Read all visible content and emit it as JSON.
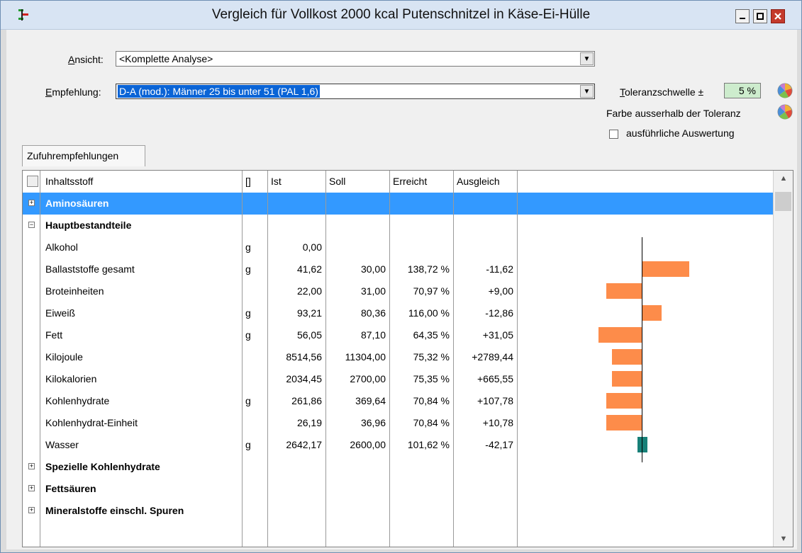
{
  "window": {
    "title": "Vergleich für Vollkost 2000 kcal Putenschnitzel in Käse-Ei-Hülle"
  },
  "controls": {
    "ansicht_label_u": "A",
    "ansicht_label_rest": "nsicht:",
    "ansicht_value": "<Komplette Analyse>",
    "empfehlung_label_u": "E",
    "empfehlung_label_rest": "mpfehlung:",
    "empfehlung_value": "D-A (mod.): Männer 25 bis unter 51 (PAL 1,6)",
    "toleranz_label_u": "T",
    "toleranz_label_rest": "oleranzschwelle ±",
    "toleranz_value": "5 %",
    "farbe_label": "Farbe ausserhalb der Toleranz",
    "ausfuehrlich_label": "ausführliche Auswertung",
    "ausfuehrlich_checked": false
  },
  "tabs": [
    "Zufuhrempfehlungen"
  ],
  "columns": {
    "name": "Inhaltsstoff",
    "unit": "[]",
    "ist": "Ist",
    "soll": "Soll",
    "erreicht": "Erreicht",
    "ausgleich": "Ausgleich"
  },
  "rows": [
    {
      "type": "group",
      "name": "Aminosäuren",
      "expanded": false,
      "selected": true
    },
    {
      "type": "group",
      "name": "Hauptbestandteile",
      "expanded": true,
      "selected": false
    },
    {
      "type": "item",
      "name": "Alkohol",
      "unit": "g",
      "ist": "0,00",
      "soll": "",
      "erreicht": "",
      "ausgleich": "",
      "percent": null
    },
    {
      "type": "item",
      "name": "Ballaststoffe gesamt",
      "unit": "g",
      "ist": "41,62",
      "soll": "30,00",
      "erreicht": "138,72 %",
      "ausgleich": "-11,62",
      "percent": 138.72
    },
    {
      "type": "item",
      "name": "Broteinheiten",
      "unit": "",
      "ist": "22,00",
      "soll": "31,00",
      "erreicht": "70,97 %",
      "ausgleich": "+9,00",
      "percent": 70.97
    },
    {
      "type": "item",
      "name": "Eiweiß",
      "unit": "g",
      "ist": "93,21",
      "soll": "80,36",
      "erreicht": "116,00 %",
      "ausgleich": "-12,86",
      "percent": 116.0
    },
    {
      "type": "item",
      "name": "Fett",
      "unit": "g",
      "ist": "56,05",
      "soll": "87,10",
      "erreicht": "64,35 %",
      "ausgleich": "+31,05",
      "percent": 64.35
    },
    {
      "type": "item",
      "name": "Kilojoule",
      "unit": "",
      "ist": "8514,56",
      "soll": "11304,00",
      "erreicht": "75,32 %",
      "ausgleich": "+2789,44",
      "percent": 75.32
    },
    {
      "type": "item",
      "name": "Kilokalorien",
      "unit": "",
      "ist": "2034,45",
      "soll": "2700,00",
      "erreicht": "75,35 %",
      "ausgleich": "+665,55",
      "percent": 75.35
    },
    {
      "type": "item",
      "name": "Kohlenhydrate",
      "unit": "g",
      "ist": "261,86",
      "soll": "369,64",
      "erreicht": "70,84 %",
      "ausgleich": "+107,78",
      "percent": 70.84
    },
    {
      "type": "item",
      "name": "Kohlenhydrat-Einheit",
      "unit": "",
      "ist": "26,19",
      "soll": "36,96",
      "erreicht": "70,84 %",
      "ausgleich": "+10,78",
      "percent": 70.84
    },
    {
      "type": "item",
      "name": "Wasser",
      "unit": "g",
      "ist": "2642,17",
      "soll": "2600,00",
      "erreicht": "101,62 %",
      "ausgleich": "-42,17",
      "percent": 101.62
    },
    {
      "type": "group",
      "name": "Spezielle Kohlenhydrate",
      "expanded": false,
      "selected": false
    },
    {
      "type": "group",
      "name": "Fettsäuren",
      "expanded": false,
      "selected": false
    },
    {
      "type": "group",
      "name": "Mineralstoffe einschl. Spuren",
      "expanded": false,
      "selected": false
    }
  ],
  "colors": {
    "bar_out_of_tolerance": "#fd8c4a",
    "bar_in_tolerance": "#178078",
    "selection": "#3399ff"
  },
  "icons": {
    "app": "tree-structure-icon",
    "minimize": "minimize-icon",
    "maximize": "maximize-icon",
    "close": "close-icon",
    "color_picker": "color-wheel-icon"
  }
}
